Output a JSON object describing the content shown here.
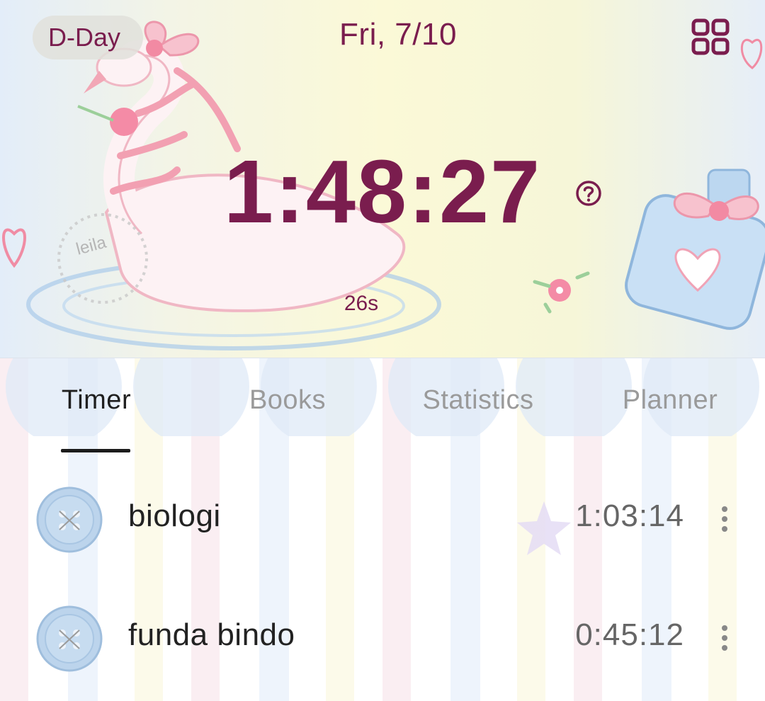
{
  "header": {
    "dday_label": "D-Day",
    "date": "Fri, 7/10",
    "grid_icon": "grid-icon",
    "help_icon": "help-circle-icon"
  },
  "timer": {
    "total": "1:48:27",
    "seconds": "26s"
  },
  "tabs": [
    {
      "label": "Timer",
      "active": true
    },
    {
      "label": "Books",
      "active": false
    },
    {
      "label": "Statistics",
      "active": false
    },
    {
      "label": "Planner",
      "active": false
    }
  ],
  "subjects": [
    {
      "name": "biologi",
      "time": "1:03:14",
      "icon": "button-icon"
    },
    {
      "name": "funda bindo",
      "time": "0:45:12",
      "icon": "button-icon"
    }
  ],
  "illustration": {
    "stamp_text": "leila"
  },
  "colors": {
    "accent": "#7a1d4e",
    "tab_inactive": "#9a9a9a",
    "tab_active": "#1f1f1f"
  }
}
